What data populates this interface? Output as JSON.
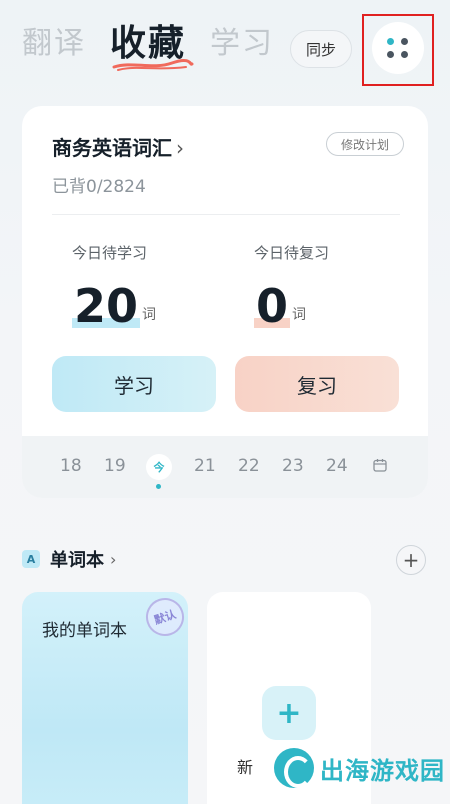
{
  "tabs": [
    {
      "label": "翻译",
      "active": false
    },
    {
      "label": "收藏",
      "active": true
    },
    {
      "label": "学习",
      "active": false
    }
  ],
  "sync_label": "同步",
  "menu_icon": "grid-dots-icon",
  "plan": {
    "title": "商务英语词汇",
    "edit_label": "修改计划",
    "progress": "已背0/2824"
  },
  "stats": {
    "learn_label": "今日待学习",
    "learn_count": "20",
    "review_label": "今日待复习",
    "review_count": "0",
    "unit": "词"
  },
  "buttons": {
    "learn": "学习",
    "review": "复习"
  },
  "calendar": {
    "days": [
      "18",
      "19",
      "今",
      "21",
      "22",
      "23",
      "24"
    ],
    "today_index": 2
  },
  "wordbook": {
    "title": "单词本",
    "icon_letter": "A",
    "books": [
      {
        "name": "我的单词本",
        "badge": "默认"
      }
    ],
    "new_label": "新"
  },
  "watermark": "出海游戏园",
  "colors": {
    "accent": "#2fb6c6",
    "learn_bg": "#bfe9f6",
    "review_bg": "#f8d2c6",
    "highlight_box": "#e02020"
  }
}
